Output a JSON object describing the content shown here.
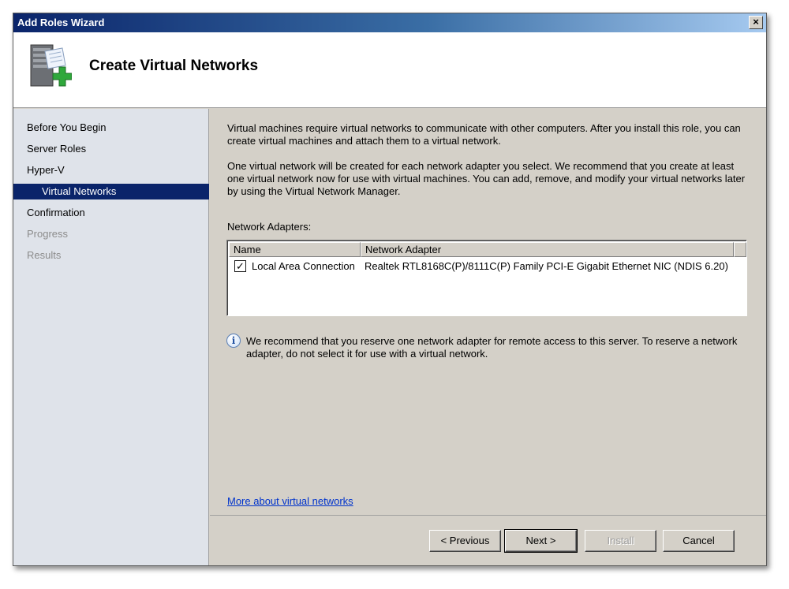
{
  "window": {
    "title": "Add Roles Wizard",
    "close_label": "×"
  },
  "header": {
    "title": "Create Virtual Networks",
    "icon": "server-add-icon"
  },
  "sidebar": {
    "items": [
      {
        "label": "Before You Begin",
        "state": "normal"
      },
      {
        "label": "Server Roles",
        "state": "normal"
      },
      {
        "label": "Hyper-V",
        "state": "normal"
      },
      {
        "label": "Virtual Networks",
        "state": "active"
      },
      {
        "label": "Confirmation",
        "state": "normal"
      },
      {
        "label": "Progress",
        "state": "disabled"
      },
      {
        "label": "Results",
        "state": "disabled"
      }
    ]
  },
  "content": {
    "intro": "Virtual machines require virtual networks to communicate with other computers. After you install this role, you can create virtual machines and attach them to a virtual network.",
    "recommend": "One virtual network will be created for each network adapter you select. We recommend that you create at least one virtual network now for use with virtual machines. You can add, remove, and modify your virtual networks later by using the Virtual Network Manager.",
    "adapters_label": "Network Adapters:",
    "columns": {
      "name": "Name",
      "adapter": "Network Adapter"
    },
    "rows": [
      {
        "checked": true,
        "check_mark": "✓",
        "name": "Local Area Connection",
        "adapter": "Realtek RTL8168C(P)/8111C(P) Family PCI-E Gigabit Ethernet NIC (NDIS 6.20)"
      }
    ],
    "info_glyph": "i",
    "info": "We recommend that you reserve one network adapter for remote access to this server. To reserve a network adapter, do not select it for use with a virtual network.",
    "more_link": "More about virtual networks"
  },
  "footer": {
    "previous": "< Previous",
    "next": "Next >",
    "install": "Install",
    "cancel": "Cancel"
  }
}
